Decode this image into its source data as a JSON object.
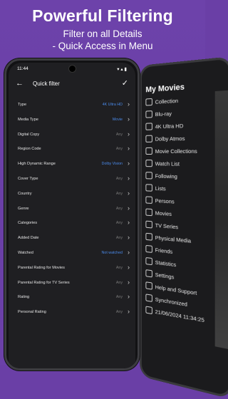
{
  "promo": {
    "headline": "Powerful Filtering",
    "line1": "Filter on all Details",
    "line2": "- Quick Access in Menu"
  },
  "status": {
    "time": "11:44",
    "icons": "▾ ▴ ▮"
  },
  "appbar": {
    "title": "Quick filter"
  },
  "filters": [
    {
      "label": "Type",
      "value": "4K Ultra HD",
      "active": true
    },
    {
      "label": "Media Type",
      "value": "Movie",
      "active": true
    },
    {
      "label": "Digital Copy",
      "value": "Any",
      "active": false
    },
    {
      "label": "Region Code",
      "value": "Any",
      "active": false
    },
    {
      "label": "High Dynamic Range",
      "value": "Dolby Vision",
      "active": true
    },
    {
      "label": "Cover Type",
      "value": "Any",
      "active": false
    },
    {
      "label": "Country",
      "value": "Any",
      "active": false
    },
    {
      "label": "Genre",
      "value": "Any",
      "active": false
    },
    {
      "label": "Categories",
      "value": "Any",
      "active": false
    },
    {
      "label": "Added Date",
      "value": "Any",
      "active": false
    },
    {
      "label": "Watched",
      "value": "Not watched",
      "active": true
    },
    {
      "label": "Parental Rating for Movies",
      "value": "Any",
      "active": false
    },
    {
      "label": "Parental Rating for TV Series",
      "value": "Any",
      "active": false
    },
    {
      "label": "Rating",
      "value": "Any",
      "active": false
    },
    {
      "label": "Personal Rating",
      "value": "Any",
      "active": false
    }
  ],
  "menu": {
    "title": "My Movies",
    "items": [
      "Collection",
      "Blu-ray",
      "4K Ultra HD",
      "Dolby Atmos",
      "Movie Collections",
      "Watch List",
      "Following",
      "Lists",
      "Persons",
      "Movies",
      "TV Series",
      "Physical Media",
      "Friends",
      "Statistics",
      "Settings",
      "Help and Support",
      "Synchronized",
      "21/06/2024 11:34:25"
    ]
  },
  "colors": {
    "accent": "#4a89e8",
    "background": "#6a3fa6"
  }
}
